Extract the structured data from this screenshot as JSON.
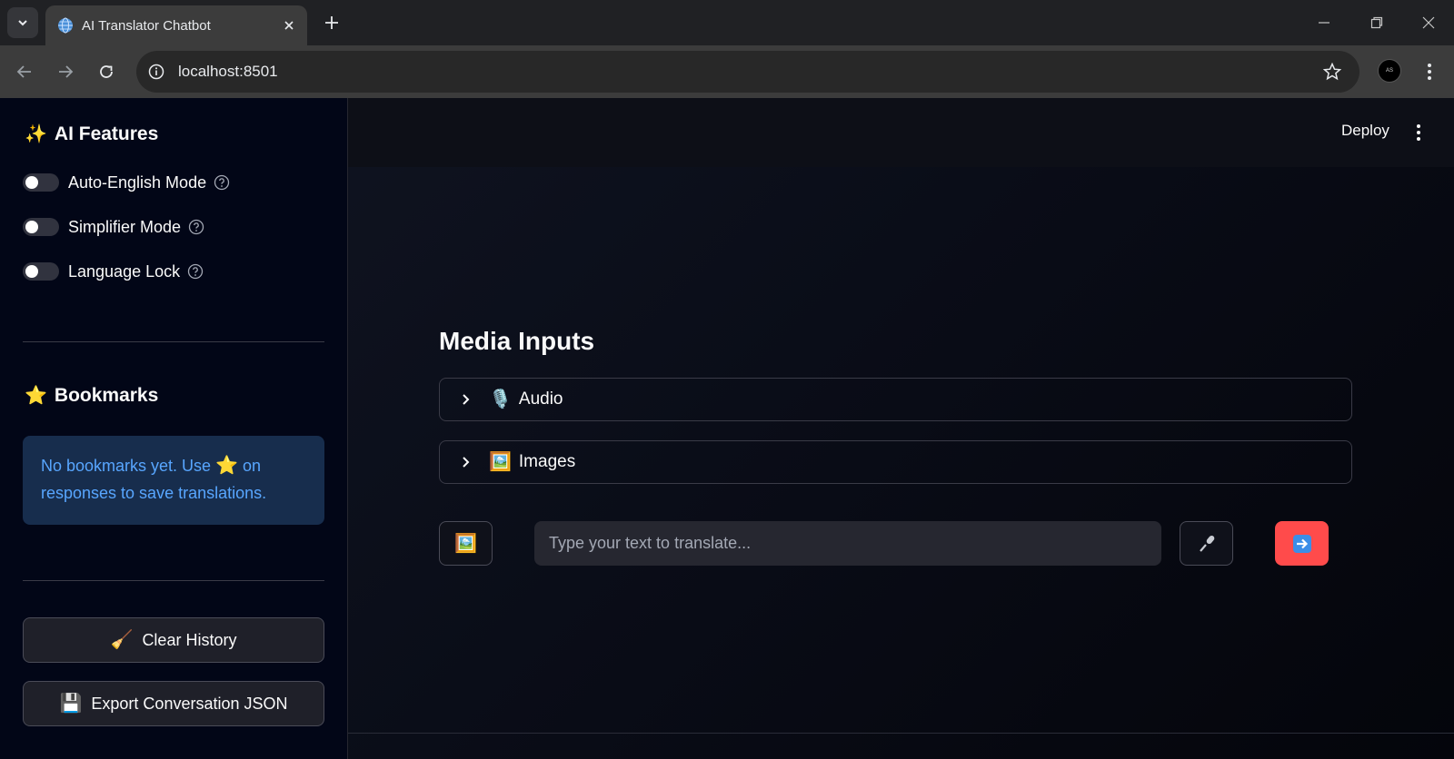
{
  "browser": {
    "tab_title": "AI Translator Chatbot",
    "url": "localhost:8501"
  },
  "sidebar": {
    "features_title": "AI Features",
    "features_icon": "sparkles-emoji",
    "toggles": [
      {
        "label": "Auto-English Mode",
        "on": false
      },
      {
        "label": "Simplifier Mode",
        "on": false
      },
      {
        "label": "Language Lock",
        "on": false
      }
    ],
    "bookmarks_title": "Bookmarks",
    "bookmarks_icon": "star-emoji",
    "bookmarks_empty_before": "No bookmarks yet. Use",
    "bookmarks_empty_after": "on responses to save translations.",
    "clear_history_label": "Clear History",
    "export_label": "Export Conversation JSON"
  },
  "header": {
    "deploy_label": "Deploy"
  },
  "main": {
    "media_title": "Media Inputs",
    "expanders": [
      {
        "label": "Audio",
        "icon": "microphone-emoji"
      },
      {
        "label": "Images",
        "icon": "framed-picture-emoji"
      }
    ],
    "input_placeholder": "Type your text to translate...",
    "input_value": ""
  },
  "colors": {
    "accent": "#ff4b4b",
    "info_text": "#58a6ff",
    "info_bg": "#172d4d",
    "sidebar_bg": "#020617"
  }
}
